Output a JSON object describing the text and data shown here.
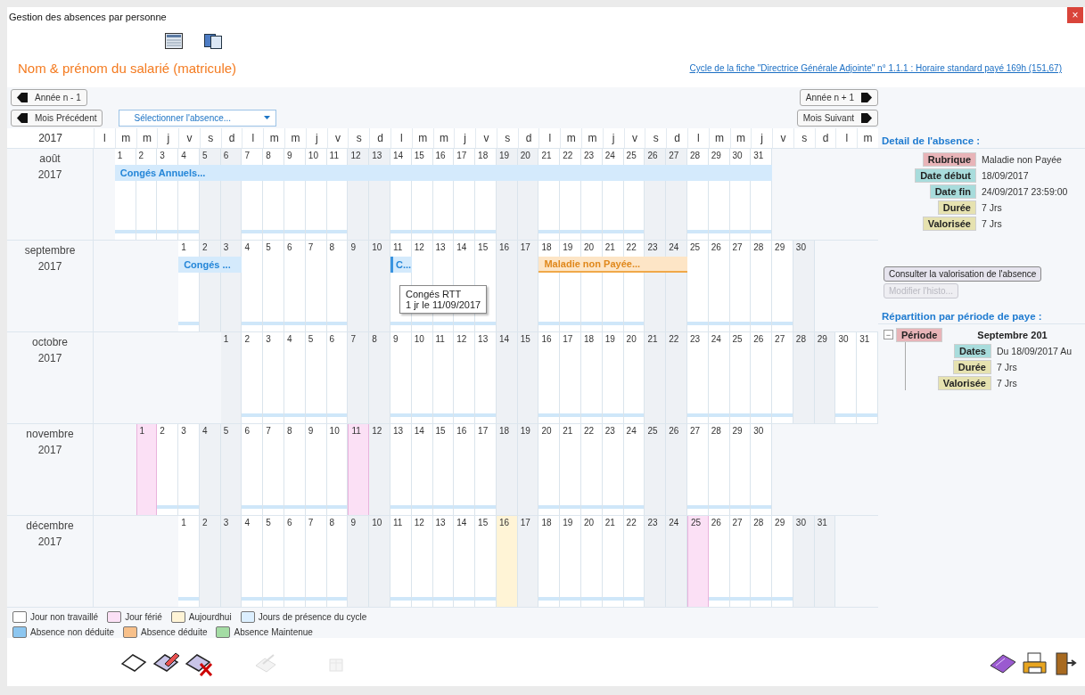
{
  "window": {
    "title": "Gestion des absences par personne",
    "close_glyph": "×"
  },
  "view_icons": [
    {
      "kind": "calendar"
    },
    {
      "kind": "windows"
    }
  ],
  "employee": "Nom & prénom du salarié (matricule)",
  "cycle_link": "Cycle de la fiche \"Directrice Générale Adjointe\" n° 1.1.1 : Horaire standard payé 169h (151,67)",
  "nav": {
    "prev_year": "Année n - 1",
    "prev_month": "Mois Précédent",
    "absence_select": "Sélectionner l'absence...",
    "next_year": "Année n + 1",
    "next_month": "Mois Suivant"
  },
  "calendar": {
    "year": "2017",
    "weekdays": [
      "l",
      "m",
      "m",
      "j",
      "v",
      "s",
      "d",
      "l",
      "m",
      "m",
      "j",
      "v",
      "s",
      "d",
      "l",
      "m",
      "m",
      "j",
      "v",
      "s",
      "d",
      "l",
      "m",
      "m",
      "j",
      "v",
      "s",
      "d",
      "l",
      "m",
      "m",
      "j",
      "v",
      "s",
      "d",
      "l",
      "m"
    ],
    "months": [
      {
        "name": "août",
        "year": "2017",
        "cells": [
          {
            "kind": "blank"
          },
          {
            "kind": "not_deducted_absence",
            "label": "Congés Annuels...",
            "days": [
              {
                "n": "1",
                "kind": "work"
              },
              {
                "n": "2",
                "kind": "work"
              },
              {
                "n": "3",
                "kind": "work"
              },
              {
                "n": "4",
                "kind": "work"
              },
              {
                "n": "5",
                "kind": "weekend"
              },
              {
                "n": "6",
                "kind": "weekend"
              },
              {
                "n": "7",
                "kind": "work"
              },
              {
                "n": "8",
                "kind": "work"
              },
              {
                "n": "9",
                "kind": "work"
              },
              {
                "n": "10",
                "kind": "work"
              },
              {
                "n": "11",
                "kind": "work"
              },
              {
                "n": "12",
                "kind": "weekend"
              },
              {
                "n": "13",
                "kind": "weekend"
              },
              {
                "n": "14",
                "kind": "work"
              },
              {
                "n": "15",
                "kind": "work"
              },
              {
                "n": "16",
                "kind": "work"
              },
              {
                "n": "17",
                "kind": "work"
              },
              {
                "n": "18",
                "kind": "work"
              },
              {
                "n": "19",
                "kind": "weekend"
              },
              {
                "n": "20",
                "kind": "weekend"
              },
              {
                "n": "21",
                "kind": "work"
              },
              {
                "n": "22",
                "kind": "work"
              },
              {
                "n": "23",
                "kind": "work"
              },
              {
                "n": "24",
                "kind": "work"
              },
              {
                "n": "25",
                "kind": "work"
              },
              {
                "n": "26",
                "kind": "weekend"
              },
              {
                "n": "27",
                "kind": "weekend"
              },
              {
                "n": "28",
                "kind": "work"
              },
              {
                "n": "29",
                "kind": "work"
              },
              {
                "n": "30",
                "kind": "work"
              },
              {
                "n": "31",
                "kind": "work"
              }
            ]
          }
        ]
      },
      {
        "name": "septembre",
        "year": "2017",
        "cells": [
          {
            "kind": "blank"
          },
          {
            "kind": "blank"
          },
          {
            "kind": "blank"
          },
          {
            "kind": "blank"
          },
          {
            "kind": "not_deducted_absence",
            "label": "Congés ...",
            "days": [
              {
                "n": "1",
                "kind": "work"
              },
              {
                "n": "2",
                "kind": "weekend"
              },
              {
                "n": "3",
                "kind": "weekend"
              }
            ]
          },
          {
            "n": "4",
            "kind": "work"
          },
          {
            "n": "5",
            "kind": "work"
          },
          {
            "n": "6",
            "kind": "work"
          },
          {
            "n": "7",
            "kind": "work"
          },
          {
            "n": "8",
            "kind": "work"
          },
          {
            "n": "9",
            "kind": "weekend"
          },
          {
            "n": "10",
            "kind": "weekend"
          },
          {
            "kind": "not_deducted_absence",
            "label": "C...",
            "days": [
              {
                "n": "11",
                "kind": "work",
                "tooltip": [
                  "Congés RTT",
                  "1 jr le 11/09/2017"
                ]
              }
            ]
          },
          {
            "n": "12",
            "kind": "work"
          },
          {
            "n": "13",
            "kind": "work"
          },
          {
            "n": "14",
            "kind": "work"
          },
          {
            "n": "15",
            "kind": "work"
          },
          {
            "n": "16",
            "kind": "weekend"
          },
          {
            "n": "17",
            "kind": "weekend"
          },
          {
            "kind": "deducted_absence",
            "label": "Maladie non Payée...",
            "days": [
              {
                "n": "18",
                "kind": "work"
              },
              {
                "n": "19",
                "kind": "work"
              },
              {
                "n": "20",
                "kind": "work"
              },
              {
                "n": "21",
                "kind": "work"
              },
              {
                "n": "22",
                "kind": "work"
              },
              {
                "n": "23",
                "kind": "weekend"
              },
              {
                "n": "24",
                "kind": "weekend"
              }
            ]
          },
          {
            "n": "25",
            "kind": "work"
          },
          {
            "n": "26",
            "kind": "work"
          },
          {
            "n": "27",
            "kind": "work"
          },
          {
            "n": "28",
            "kind": "work"
          },
          {
            "n": "29",
            "kind": "work"
          },
          {
            "n": "30",
            "kind": "weekend"
          }
        ]
      },
      {
        "name": "octobre",
        "year": "2017",
        "cells": [
          {
            "kind": "blank"
          },
          {
            "kind": "blank"
          },
          {
            "kind": "blank"
          },
          {
            "kind": "blank"
          },
          {
            "kind": "blank"
          },
          {
            "kind": "blank"
          },
          {
            "n": "1",
            "kind": "weekend"
          },
          {
            "n": "2",
            "kind": "work"
          },
          {
            "n": "3",
            "kind": "work"
          },
          {
            "n": "4",
            "kind": "work"
          },
          {
            "n": "5",
            "kind": "work"
          },
          {
            "n": "6",
            "kind": "work"
          },
          {
            "n": "7",
            "kind": "weekend"
          },
          {
            "n": "8",
            "kind": "weekend"
          },
          {
            "n": "9",
            "kind": "work"
          },
          {
            "n": "10",
            "kind": "work"
          },
          {
            "n": "11",
            "kind": "work"
          },
          {
            "n": "12",
            "kind": "work"
          },
          {
            "n": "13",
            "kind": "work"
          },
          {
            "n": "14",
            "kind": "weekend"
          },
          {
            "n": "15",
            "kind": "weekend"
          },
          {
            "n": "16",
            "kind": "work"
          },
          {
            "n": "17",
            "kind": "work"
          },
          {
            "n": "18",
            "kind": "work"
          },
          {
            "n": "19",
            "kind": "work"
          },
          {
            "n": "20",
            "kind": "work"
          },
          {
            "n": "21",
            "kind": "weekend"
          },
          {
            "n": "22",
            "kind": "weekend"
          },
          {
            "n": "23",
            "kind": "work"
          },
          {
            "n": "24",
            "kind": "work"
          },
          {
            "n": "25",
            "kind": "work"
          },
          {
            "n": "26",
            "kind": "work"
          },
          {
            "n": "27",
            "kind": "work"
          },
          {
            "n": "28",
            "kind": "weekend"
          },
          {
            "n": "29",
            "kind": "weekend"
          },
          {
            "n": "30",
            "kind": "work"
          },
          {
            "n": "31",
            "kind": "work"
          }
        ]
      },
      {
        "name": "novembre",
        "year": "2017",
        "cells": [
          {
            "kind": "blank"
          },
          {
            "kind": "blank"
          },
          {
            "n": "1",
            "kind": "holiday"
          },
          {
            "n": "2",
            "kind": "work"
          },
          {
            "n": "3",
            "kind": "work"
          },
          {
            "n": "4",
            "kind": "weekend"
          },
          {
            "n": "5",
            "kind": "weekend"
          },
          {
            "n": "6",
            "kind": "work"
          },
          {
            "n": "7",
            "kind": "work"
          },
          {
            "n": "8",
            "kind": "work"
          },
          {
            "n": "9",
            "kind": "work"
          },
          {
            "n": "10",
            "kind": "work"
          },
          {
            "n": "11",
            "kind": "holiday"
          },
          {
            "n": "12",
            "kind": "weekend"
          },
          {
            "n": "13",
            "kind": "work"
          },
          {
            "n": "14",
            "kind": "work"
          },
          {
            "n": "15",
            "kind": "work"
          },
          {
            "n": "16",
            "kind": "work"
          },
          {
            "n": "17",
            "kind": "work"
          },
          {
            "n": "18",
            "kind": "weekend"
          },
          {
            "n": "19",
            "kind": "weekend"
          },
          {
            "n": "20",
            "kind": "work"
          },
          {
            "n": "21",
            "kind": "work"
          },
          {
            "n": "22",
            "kind": "work"
          },
          {
            "n": "23",
            "kind": "work"
          },
          {
            "n": "24",
            "kind": "work"
          },
          {
            "n": "25",
            "kind": "weekend"
          },
          {
            "n": "26",
            "kind": "weekend"
          },
          {
            "n": "27",
            "kind": "work"
          },
          {
            "n": "28",
            "kind": "work"
          },
          {
            "n": "29",
            "kind": "work"
          },
          {
            "n": "30",
            "kind": "work"
          }
        ]
      },
      {
        "name": "décembre",
        "year": "2017",
        "cells": [
          {
            "kind": "blank"
          },
          {
            "kind": "blank"
          },
          {
            "kind": "blank"
          },
          {
            "kind": "blank"
          },
          {
            "n": "1",
            "kind": "work"
          },
          {
            "n": "2",
            "kind": "weekend"
          },
          {
            "n": "3",
            "kind": "weekend"
          },
          {
            "n": "4",
            "kind": "work"
          },
          {
            "n": "5",
            "kind": "work"
          },
          {
            "n": "6",
            "kind": "work"
          },
          {
            "n": "7",
            "kind": "work"
          },
          {
            "n": "8",
            "kind": "work"
          },
          {
            "n": "9",
            "kind": "weekend"
          },
          {
            "n": "10",
            "kind": "weekend"
          },
          {
            "n": "11",
            "kind": "work"
          },
          {
            "n": "12",
            "kind": "work"
          },
          {
            "n": "13",
            "kind": "work"
          },
          {
            "n": "14",
            "kind": "work"
          },
          {
            "n": "15",
            "kind": "work"
          },
          {
            "n": "16",
            "kind": "today"
          },
          {
            "n": "17",
            "kind": "weekend"
          },
          {
            "n": "18",
            "kind": "work"
          },
          {
            "n": "19",
            "kind": "work"
          },
          {
            "n": "20",
            "kind": "work"
          },
          {
            "n": "21",
            "kind": "work"
          },
          {
            "n": "22",
            "kind": "work"
          },
          {
            "n": "23",
            "kind": "weekend"
          },
          {
            "n": "24",
            "kind": "weekend"
          },
          {
            "n": "25",
            "kind": "holiday"
          },
          {
            "n": "26",
            "kind": "work"
          },
          {
            "n": "27",
            "kind": "work"
          },
          {
            "n": "28",
            "kind": "work"
          },
          {
            "n": "29",
            "kind": "work"
          },
          {
            "n": "30",
            "kind": "weekend"
          },
          {
            "n": "31",
            "kind": "weekend"
          }
        ]
      }
    ]
  },
  "detail": {
    "heading": "Detail de l'absence :",
    "fields": [
      {
        "label": "Rubrique",
        "value": "Maladie non Payée",
        "color": "#e8b4b8"
      },
      {
        "label": "Date début",
        "value": "18/09/2017",
        "color": "#a8dcdc"
      },
      {
        "label": "Date fin",
        "value": "24/09/2017 23:59:00",
        "color": "#a8dcdc"
      },
      {
        "label": "Durée",
        "value": "7 Jrs",
        "color": "#e6e2b0"
      },
      {
        "label": "Valorisée",
        "value": "7 Jrs",
        "color": "#e6e2b0"
      }
    ],
    "buttons": [
      {
        "label": "Consulter la valorisation de l'absence",
        "disabled": false
      },
      {
        "label": "Modifier l'histo...",
        "disabled": true
      }
    ]
  },
  "breakdown": {
    "heading": "Répartition par période de paye :",
    "tree": {
      "label": "Période",
      "value": "Septembre 201",
      "color": "#e8b4b8",
      "expanded": true,
      "toggle_glyph": "−",
      "children": [
        {
          "label": "Dates",
          "value": "Du 18/09/2017 Au",
          "color": "#a8dcdc"
        },
        {
          "label": "Durée",
          "value": "7 Jrs",
          "color": "#e6e2b0"
        },
        {
          "label": "Valorisée",
          "value": "7 Jrs",
          "color": "#e6e2b0"
        }
      ]
    }
  },
  "legend": [
    {
      "label": "Jour non travaillé",
      "color": "#ffffff"
    },
    {
      "label": "Jour férié",
      "color": "#fbe0f5"
    },
    {
      "label": "Aujourdhui",
      "color": "#fff4d6"
    },
    {
      "label": "Jours de présence du cycle",
      "color": "#dcefff"
    },
    {
      "label": "Absence non déduite",
      "color": "#8cc6f0"
    },
    {
      "label": "Absence déduite",
      "color": "#f7c08a"
    },
    {
      "label": "Absence Maintenue",
      "color": "#a4dca4"
    }
  ],
  "toolbar": {
    "left": [
      {
        "kind": "new",
        "disabled": false
      },
      {
        "kind": "edit",
        "disabled": false
      },
      {
        "kind": "delete",
        "disabled": false
      },
      {
        "kind": "sign",
        "disabled": true
      },
      {
        "kind": "box",
        "disabled": true
      }
    ],
    "right": [
      {
        "kind": "card",
        "disabled": false
      },
      {
        "kind": "print",
        "disabled": false
      },
      {
        "kind": "exit",
        "disabled": false
      }
    ]
  }
}
